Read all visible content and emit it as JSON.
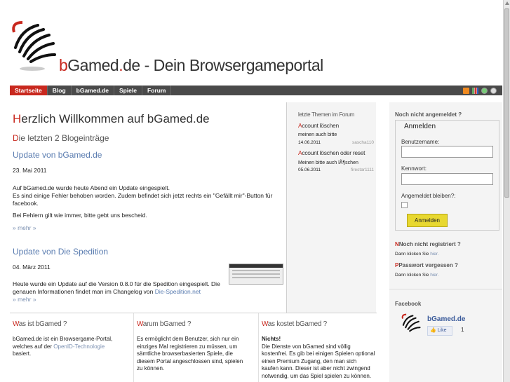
{
  "header": {
    "title_b": "b",
    "title_gamed": "Gamed",
    "title_dot": ".",
    "title_rest": "de - Dein Browsergameportal"
  },
  "nav": {
    "items": [
      "Startseite",
      "Blog",
      "bGamed.de",
      "Spiele",
      "Forum"
    ],
    "active": "Startseite",
    "icons": [
      "rss-icon",
      "stats-icon",
      "settings-icon",
      "status-icon"
    ]
  },
  "main": {
    "welcome_first": "H",
    "welcome_rest": "erzlich Willkommen auf bGamed.de",
    "blog_first": "D",
    "blog_rest": "ie letzten 2 Blogeinträge",
    "posts": [
      {
        "title": "Update von bGamed.de",
        "date": "23. Mai 2011",
        "line1": "Auf bGamed.de wurde heute Abend ein Update eingespielt.",
        "line2": "Es sind einige Fehler behoben worden. Zudem befindet sich jetzt rechts ein \"Gefällt mir\"-Button für",
        "line3": "facebook.",
        "line4": "Bei Fehlern gilt wie immer, bitte gebt uns bescheid.",
        "more": "» mehr »"
      },
      {
        "title": "Update von Die Spedition",
        "date": "04. März 2011",
        "line1": "Heute wurde ein Update auf die Version 0.8.0 für die Spedition eingespielt. Die",
        "line2": "genauen Informationen findet man im Changelog von",
        "link": "Die-Spedition.net",
        "more": "» mehr »"
      }
    ]
  },
  "topics": {
    "head": "letzte Themen im Forum",
    "items": [
      {
        "title_first": "A",
        "title_rest": "ccount löschen",
        "text": "meinen auch bitte",
        "date": "14.06.2011",
        "user": "sascha110"
      },
      {
        "title_first": "A",
        "title_rest": "ccount löschen oder reset",
        "text": "Meinen bitte auch lÃ¶schen",
        "date": "05.06.2011",
        "user": "firestar1111"
      }
    ]
  },
  "sidebar": {
    "login_head": "Noch nicht angemeldet ?",
    "legend": "Anmelden",
    "username_label": "Benutzername:",
    "password_label": "Kennwort:",
    "remember_label": "Angemeldet bleiben?:",
    "login_button": "Anmelden",
    "register_head": "Noch nicht registriert ?",
    "register_text": "Dann klicken Sie",
    "register_link": "hier.",
    "forgot_head": "Passwort vergessen ?",
    "forgot_text": "Dann klicken Sie",
    "forgot_link": "hier.",
    "facebook_head": "Facebook",
    "facebook_name": "bGamed.de",
    "facebook_like": "Like",
    "facebook_count": "1"
  },
  "bottom": {
    "columns": [
      {
        "head_first": "W",
        "head_rest": "as ist bGamed ?",
        "l1": "bGamed.de ist ein Browsergame-Portal,",
        "l2": "welches auf der",
        "link": "OpenID-Technologie",
        "l3": "basiert."
      },
      {
        "head_first": "W",
        "head_rest": "arum bGamed ?",
        "l1": "Es ermöglicht dem Benutzer, sich nur ein",
        "l2": "einziges Mal registrieren zu müssen, um",
        "l3": "sämtliche browserbasierten Spiele, die",
        "l4": "diesem Portal angeschlossen sind, spielen",
        "l5": "zu können."
      },
      {
        "head_first": "W",
        "head_rest": "as kostet bGamed ?",
        "bold": "Nichts!",
        "l1": "Die Dienste von bGamed sind völlig",
        "l2": "kostenfrei. Es gib bei einigen Spielen optional",
        "l3": "einen Premium Zugang, den man sich",
        "l4": "kaufen kann. Dieser ist aber nicht zwingend",
        "l5": "notwendig, um das Spiel spielen zu können."
      }
    ]
  }
}
